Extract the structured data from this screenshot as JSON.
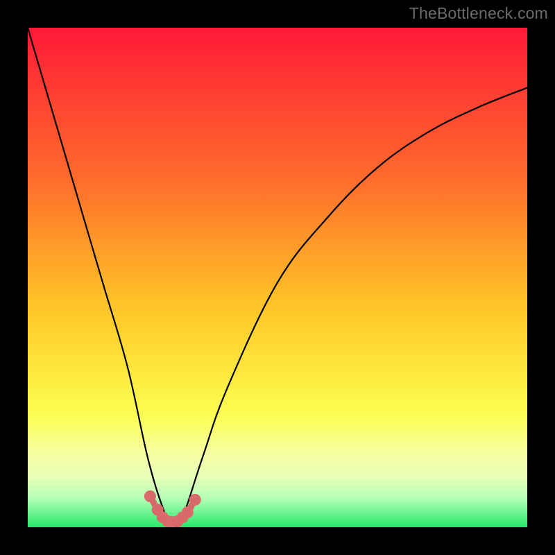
{
  "watermark": {
    "text": "TheBottleneck.com"
  },
  "chart_data": {
    "type": "line",
    "title": "",
    "xlabel": "",
    "ylabel": "",
    "xlim": [
      0,
      100
    ],
    "ylim": [
      0,
      100
    ],
    "background_gradient_meaning": "red = worse / high bottleneck, green = better / low bottleneck",
    "series": [
      {
        "name": "bottleneck-curve",
        "x": [
          0,
          5,
          10,
          15,
          20,
          24,
          27,
          29,
          31,
          35,
          40,
          50,
          60,
          70,
          80,
          90,
          100
        ],
        "values": [
          100,
          83,
          66,
          49,
          32,
          14,
          4,
          0,
          2,
          14,
          28,
          49,
          62,
          72,
          79,
          84,
          88
        ]
      }
    ],
    "markers": {
      "name": "trough-markers",
      "color": "#d86a6a",
      "x": [
        24.5,
        26.0,
        27.0,
        28.0,
        29.0,
        30.0,
        31.0,
        32.0,
        33.5
      ],
      "values": [
        6.2,
        3.5,
        2.0,
        1.2,
        1.0,
        1.2,
        2.0,
        3.0,
        5.5
      ]
    }
  }
}
